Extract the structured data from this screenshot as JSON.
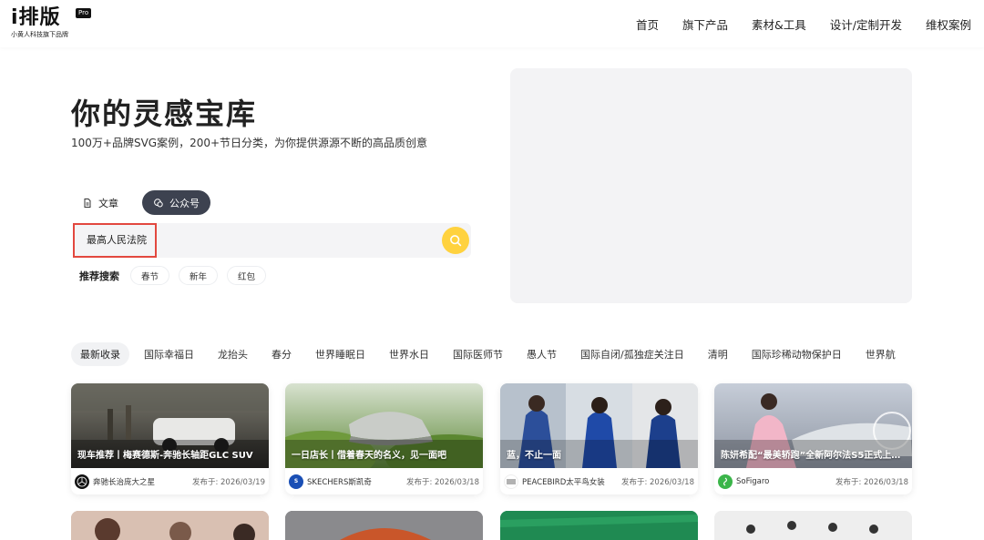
{
  "logo": {
    "main": "i排版",
    "badge": "Pro",
    "sub": "小黄人科技旗下品牌"
  },
  "nav": [
    "首页",
    "旗下产品",
    "素材&工具",
    "设计/定制开发",
    "维权案例"
  ],
  "hero": {
    "title": "你的灵感宝库",
    "subtitle": "100万+品牌SVG案例，200+节日分类，为你提供源源不断的高品质创意"
  },
  "type_tabs": {
    "article": "文章",
    "official": "公众号",
    "active": "official"
  },
  "search": {
    "value": "最高人民法院",
    "icon": "search-icon"
  },
  "recommend": {
    "label": "推荐搜索",
    "chips": [
      "春节",
      "新年",
      "红包"
    ]
  },
  "categories": [
    "最新收录",
    "国际幸福日",
    "龙抬头",
    "春分",
    "世界睡眠日",
    "世界水日",
    "国际医师节",
    "愚人节",
    "国际自闭/孤独症关注日",
    "清明",
    "国际珍稀动物保护日",
    "世界航"
  ],
  "cards": [
    {
      "title": "现车推荐丨梅赛德斯-奔驰长轴距GLC SUV",
      "account": "奔驰长治庞大之星",
      "date": "发布于: 2026/03/19",
      "avatar_color": "#111111",
      "avatar_text": ""
    },
    {
      "title": "一日店长丨借着春天的名义，见一面吧",
      "account": "SKECHERS斯凯奇",
      "date": "发布于: 2026/03/18",
      "avatar_color": "#1a4fb5",
      "avatar_text": "S"
    },
    {
      "title": "蓝，不止一面",
      "account": "PEACEBIRD太平鸟女装",
      "date": "发布于: 2026/03/18",
      "avatar_color": "#ffffff",
      "avatar_text": ""
    },
    {
      "title": "陈妍希配“最美轿跑”全新阿尔法S5正式上…",
      "account": "SoFigaro",
      "date": "发布于: 2026/03/18",
      "avatar_color": "#3bb54a",
      "avatar_text": ""
    }
  ]
}
